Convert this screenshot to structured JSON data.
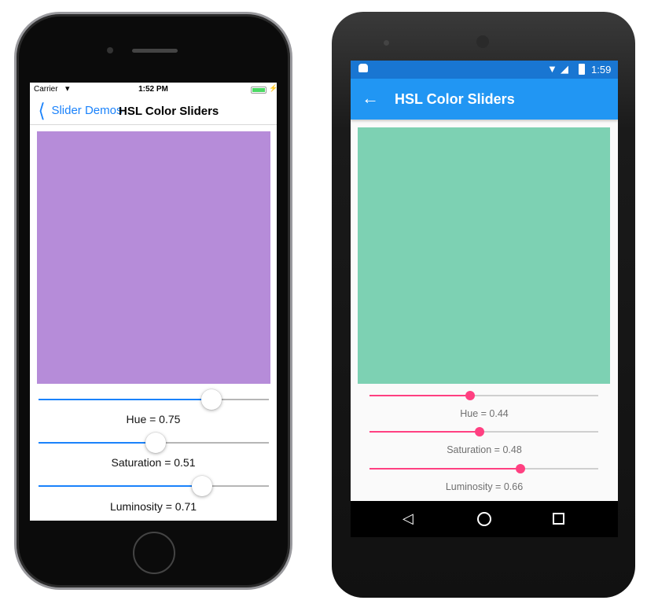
{
  "ios": {
    "status": {
      "carrier": "Carrier",
      "time": "1:52 PM"
    },
    "nav": {
      "back_label": "Slider Demos",
      "title": "HSL Color Sliders"
    },
    "swatch_color": "#b68cd9",
    "accent": "#1a82fb",
    "sliders": [
      {
        "label": "Hue = 0.75",
        "value": 0.75
      },
      {
        "label": "Saturation = 0.51",
        "value": 0.51
      },
      {
        "label": "Luminosity = 0.71",
        "value": 0.71
      }
    ]
  },
  "android": {
    "status": {
      "time": "1:59"
    },
    "appbar": {
      "title": "HSL Color Sliders"
    },
    "swatch_color": "#7dd1b3",
    "accent": "#ff4081",
    "sliders": [
      {
        "label": "Hue = 0.44",
        "value": 0.44
      },
      {
        "label": "Saturation = 0.48",
        "value": 0.48
      },
      {
        "label": "Luminosity = 0.66",
        "value": 0.66
      }
    ]
  }
}
